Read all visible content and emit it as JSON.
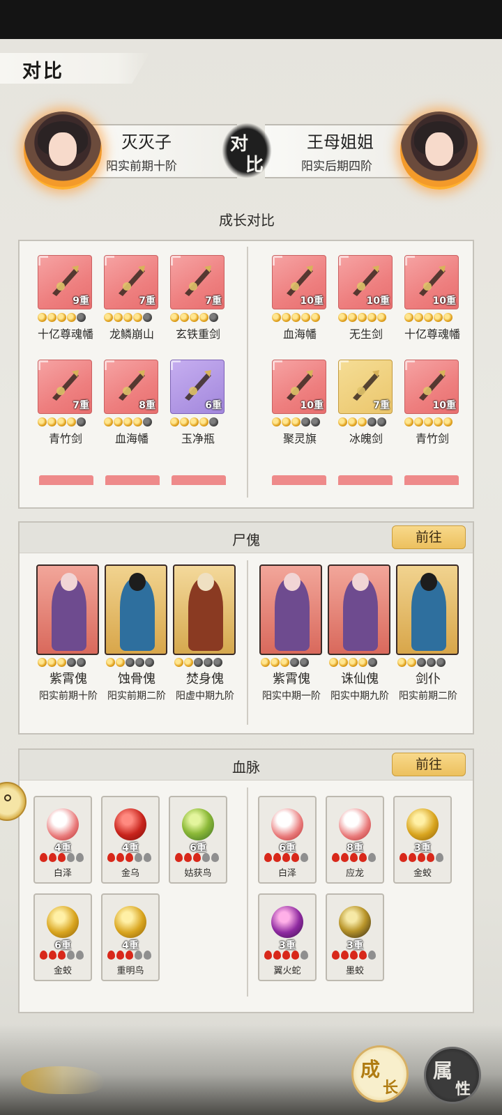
{
  "page": {
    "title": "对比"
  },
  "compare": {
    "vs_label_1": "对",
    "vs_label_2": "比",
    "left_player": {
      "name": "灭灭子",
      "rank": "阳实前期十阶"
    },
    "right_player": {
      "name": "王母姐姐",
      "rank": "阳实后期四阶"
    }
  },
  "growth": {
    "title": "成长对比",
    "left_items": [
      {
        "name": "十亿尊魂幡",
        "level": "9重",
        "stars": 4,
        "color": "red",
        "icon": "soul-banner-icon"
      },
      {
        "name": "龙鳞崩山",
        "level": "7重",
        "stars": 4,
        "color": "red",
        "icon": "dragon-scale-blade-icon"
      },
      {
        "name": "玄铁重剑",
        "level": "7重",
        "stars": 4,
        "color": "red",
        "icon": "heavy-sword-icon"
      },
      {
        "name": "青竹剑",
        "level": "7重",
        "stars": 4,
        "color": "red",
        "icon": "bamboo-sword-icon"
      },
      {
        "name": "血海幡",
        "level": "8重",
        "stars": 4,
        "color": "red",
        "icon": "blood-sea-banner-icon"
      },
      {
        "name": "玉净瓶",
        "level": "6重",
        "stars": 4,
        "color": "purple",
        "icon": "jade-vase-icon"
      }
    ],
    "right_items": [
      {
        "name": "血海幡",
        "level": "10重",
        "stars": 5,
        "color": "red",
        "icon": "blood-sea-banner-icon"
      },
      {
        "name": "无生剑",
        "level": "10重",
        "stars": 5,
        "color": "red",
        "icon": "lifeless-sword-icon"
      },
      {
        "name": "十亿尊魂幡",
        "level": "10重",
        "stars": 5,
        "color": "red",
        "icon": "soul-banner-icon"
      },
      {
        "name": "聚灵旗",
        "level": "10重",
        "stars": 3,
        "color": "red",
        "icon": "spirit-flag-icon"
      },
      {
        "name": "冰魄剑",
        "level": "7重",
        "stars": 3,
        "color": "gold",
        "icon": "ice-sword-icon"
      },
      {
        "name": "青竹剑",
        "level": "10重",
        "stars": 5,
        "color": "red",
        "icon": "bamboo-sword-icon"
      }
    ]
  },
  "puppets": {
    "title": "尸傀",
    "goto": "前往",
    "left": [
      {
        "name": "紫霄傀",
        "rank": "阳实前期十阶",
        "stars": 3,
        "color": "red"
      },
      {
        "name": "蚀骨傀",
        "rank": "阳实前期二阶",
        "stars": 2,
        "color": "gold"
      },
      {
        "name": "焚身傀",
        "rank": "阳虚中期九阶",
        "stars": 2,
        "color": "gold2"
      }
    ],
    "right": [
      {
        "name": "紫霄傀",
        "rank": "阳实中期一阶",
        "stars": 3,
        "color": "red"
      },
      {
        "name": "诛仙傀",
        "rank": "阳实中期九阶",
        "stars": 4,
        "color": "red"
      },
      {
        "name": "剑仆",
        "rank": "阳实前期二阶",
        "stars": 2,
        "color": "gold"
      }
    ]
  },
  "bloodline": {
    "title": "血脉",
    "goto": "前往",
    "left": [
      {
        "name": "白泽",
        "level": "4重",
        "drops": 3,
        "orb": "white"
      },
      {
        "name": "金乌",
        "level": "4重",
        "drops": 3,
        "orb": "red"
      },
      {
        "name": "姑获鸟",
        "level": "6重",
        "drops": 3,
        "orb": "green"
      },
      {
        "name": "金蛟",
        "level": "6重",
        "drops": 3,
        "orb": "gold"
      },
      {
        "name": "重明鸟",
        "level": "4重",
        "drops": 3,
        "orb": "gold"
      }
    ],
    "right": [
      {
        "name": "白泽",
        "level": "6重",
        "drops": 4,
        "orb": "white"
      },
      {
        "name": "应龙",
        "level": "8重",
        "drops": 4,
        "orb": "white"
      },
      {
        "name": "金蛟",
        "level": "3重",
        "drops": 4,
        "orb": "gold"
      },
      {
        "name": "翼火蛇",
        "level": "3重",
        "drops": 4,
        "orb": "purple"
      },
      {
        "name": "墨蛟",
        "level": "3重",
        "drops": 4,
        "orb": "dark"
      }
    ]
  },
  "bottom": {
    "grow_1": "成",
    "grow_2": "长",
    "attr_1": "属",
    "attr_2": "性"
  }
}
